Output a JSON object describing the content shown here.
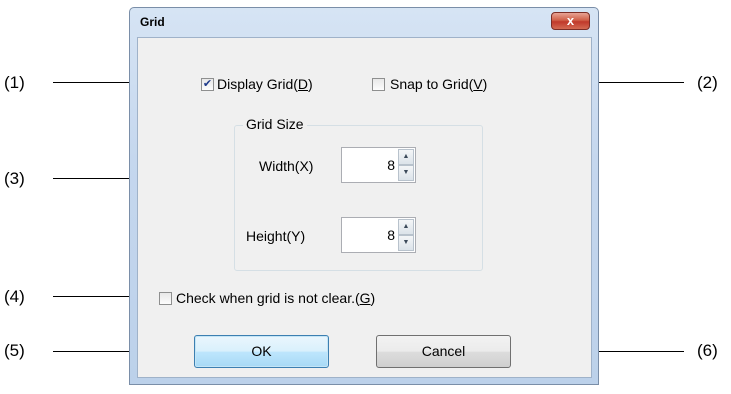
{
  "callouts": [
    "(1)",
    "(2)",
    "(3)",
    "(4)",
    "(5)",
    "(6)"
  ],
  "dialog": {
    "title": "Grid",
    "close_glyph": "x"
  },
  "display_grid": {
    "label": "Display Grid(",
    "accel": "D",
    "suffix": ")",
    "checked": true,
    "check_glyph": "✔"
  },
  "snap_to_grid": {
    "label": "Snap to Grid(",
    "accel": "V",
    "suffix": ")",
    "checked": false
  },
  "grid_size": {
    "title": "Grid Size",
    "width_label": "Width(X)",
    "width_value": "8",
    "height_label": "Height(Y)",
    "height_value": "8",
    "up_glyph": "▲",
    "down_glyph": "▼"
  },
  "check_clear": {
    "label": "Check when grid is not clear.(",
    "accel": "G",
    "suffix": ")",
    "checked": false
  },
  "buttons": {
    "ok": "OK",
    "cancel": "Cancel"
  }
}
